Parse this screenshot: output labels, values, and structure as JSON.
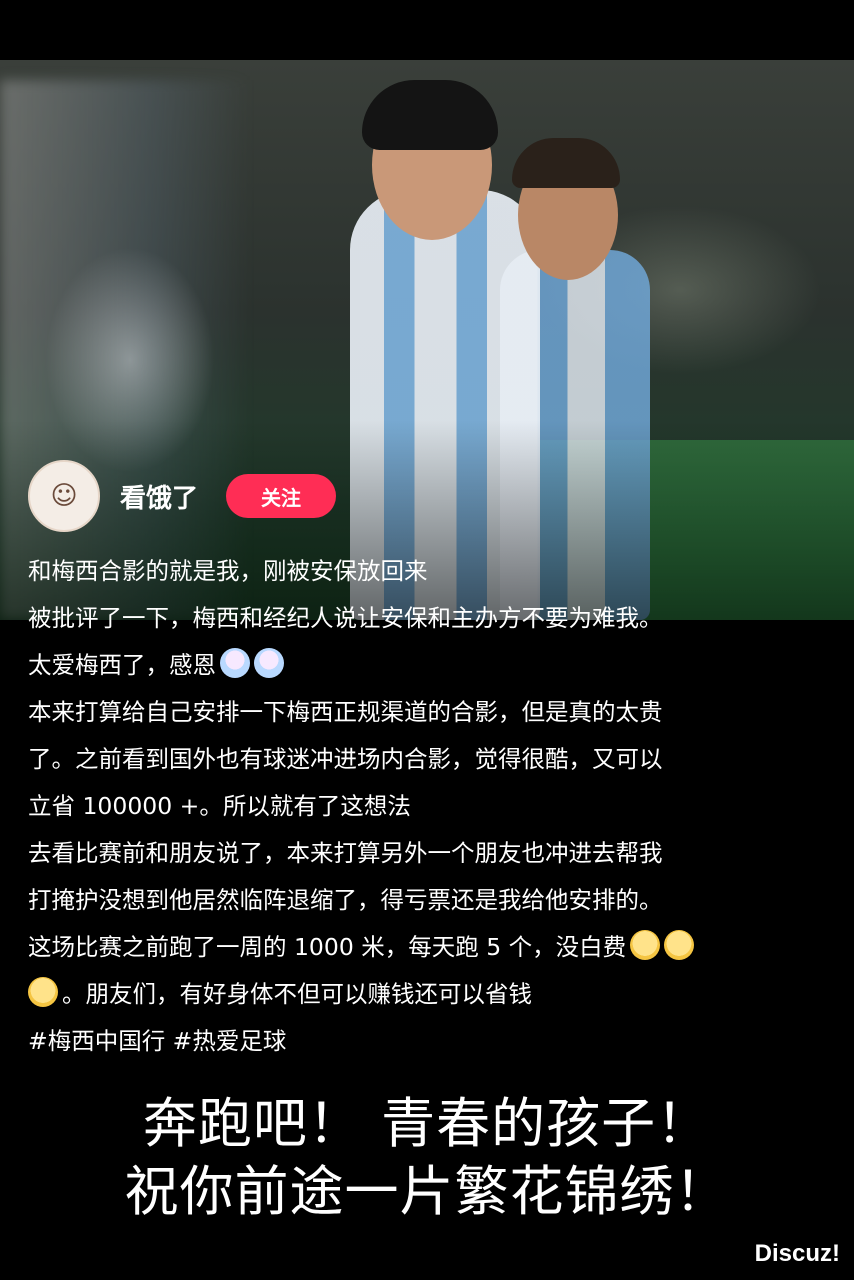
{
  "user": {
    "name": "看饿了",
    "follow_label": "关注"
  },
  "post": {
    "lines": [
      "和梅西合影的就是我，刚被安保放回来",
      "被批评了一下，梅西和经纪人说让安保和主办方不要为难我。",
      "太爱梅西了，感恩",
      "本来打算给自己安排一下梅西正规渠道的合影，但是真的太贵",
      "了。之前看到国外也有球迷冲进场内合影，觉得很酷，又可以",
      "立省 100000 +。所以就有了这想法",
      "去看比赛前和朋友说了，本来打算另外一个朋友也冲进去帮我",
      "打掩护没想到他居然临阵退缩了，得亏票还是我给他安排的。",
      "这场比赛之前跑了一周的 1000 米，每天跑 5 个，没白费",
      "。朋友们，有好身体不但可以赚钱还可以省钱"
    ],
    "tags": "#梅西中国行  #热爱足球"
  },
  "caption": {
    "line1": "奔跑吧！ 青春的孩子！",
    "line2": "祝你前途一片繁花锦绣！"
  },
  "watermark": "Discuz!",
  "colors": {
    "follow_button": "#ff2d55",
    "background": "#000000"
  },
  "icons": [
    "avatar",
    "cake-emoji",
    "tear-emoji"
  ]
}
